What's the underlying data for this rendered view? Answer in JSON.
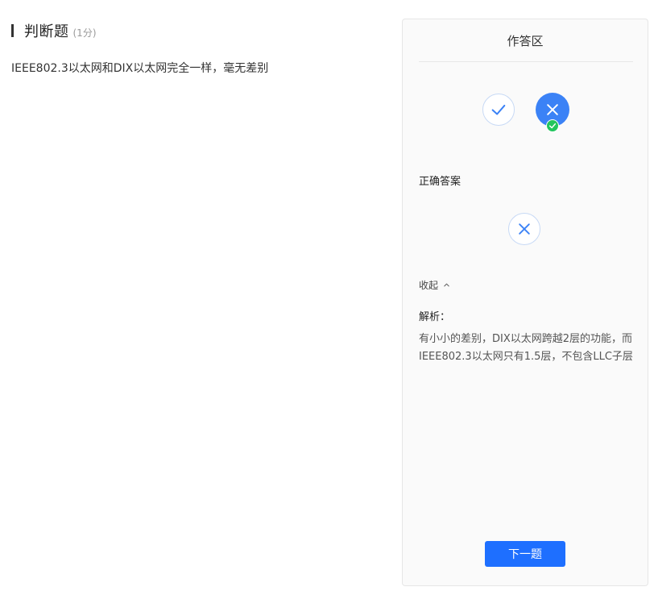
{
  "question": {
    "type": "判断题",
    "score": "(1分)",
    "text": "IEEE802.3以太网和DIX以太网完全一样，毫无差别"
  },
  "panel": {
    "title": "作答区",
    "choices": [
      {
        "icon": "check-icon",
        "selected": false
      },
      {
        "icon": "close-icon",
        "selected": true,
        "badge": "check-circle-icon"
      }
    ],
    "correct_label": "正确答案",
    "correct_icon": "close-icon",
    "collapse_label": "收起",
    "collapse_icon": "chevron-up-icon",
    "analysis_label": "解析：",
    "analysis_text": "有小小的差别，DIX以太网跨越2层的功能，而IEEE802.3以太网只有1.5层，不包含LLC子层",
    "next_button": "下一题"
  },
  "colors": {
    "accent": "#1e6fff",
    "selected": "#3b82f6",
    "success": "#22c55e"
  }
}
